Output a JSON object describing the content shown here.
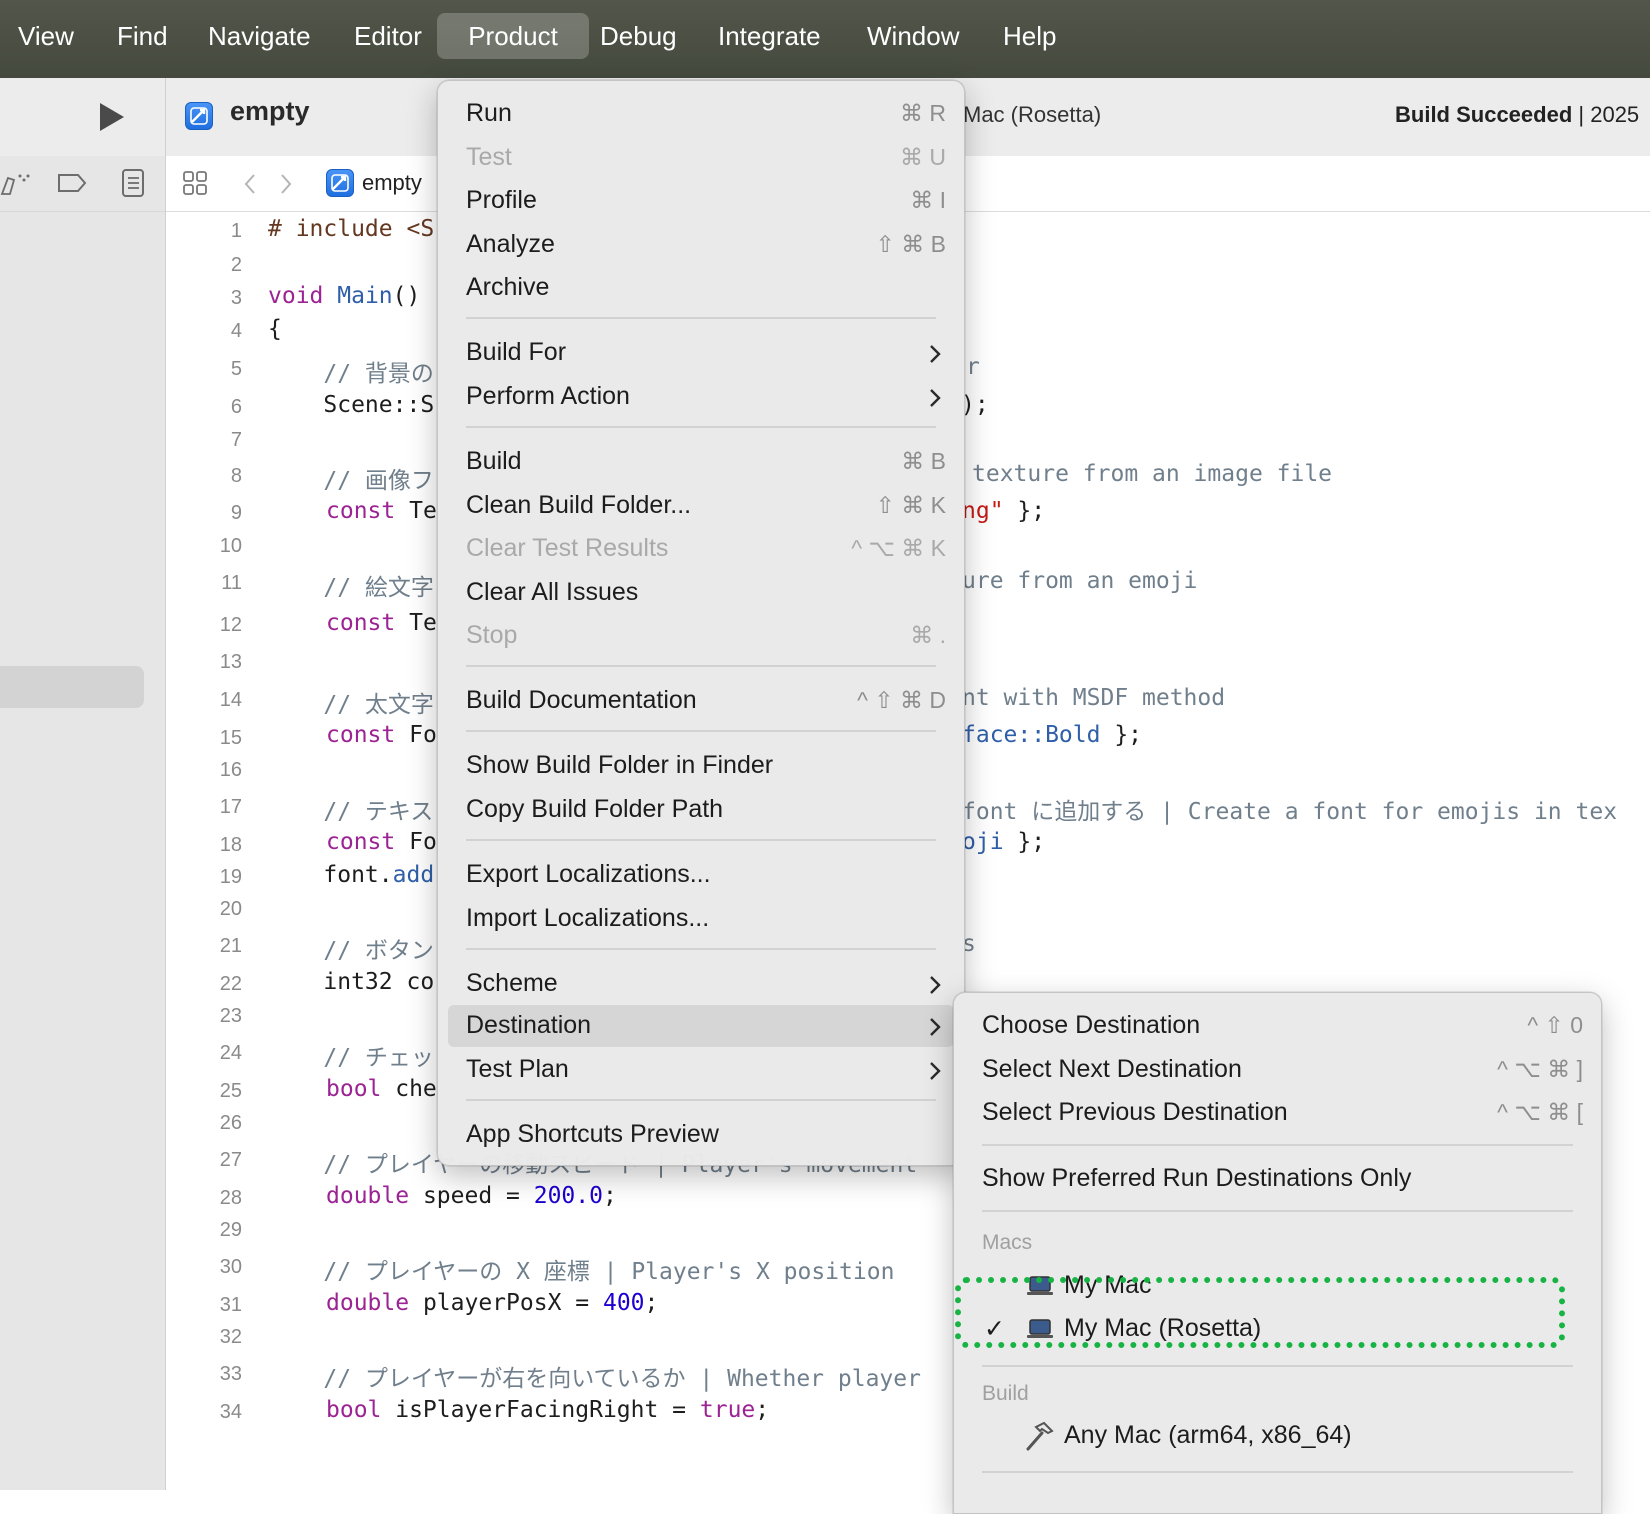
{
  "menubar": {
    "items": [
      "View",
      "Find",
      "Navigate",
      "Editor",
      "Product",
      "Debug",
      "Integrate",
      "Window",
      "Help"
    ],
    "active": "Product"
  },
  "toolbar": {
    "project": "empty",
    "destination": "Mac (Rosetta)",
    "status_bold": "Build Succeeded",
    "status_tail": " | 2025"
  },
  "jumpbar": {
    "file": "empty"
  },
  "editor": {
    "lines": [
      {
        "n": "1"
      },
      {
        "n": "2"
      },
      {
        "n": "3"
      },
      {
        "n": "4"
      },
      {
        "n": "5"
      },
      {
        "n": "6"
      },
      {
        "n": "7"
      },
      {
        "n": "8"
      },
      {
        "n": "9"
      },
      {
        "n": "10"
      },
      {
        "n": "11"
      },
      {
        "n": "12"
      },
      {
        "n": "13"
      },
      {
        "n": "14"
      },
      {
        "n": "15"
      },
      {
        "n": "16"
      },
      {
        "n": "17"
      },
      {
        "n": "18"
      },
      {
        "n": "19"
      },
      {
        "n": "20"
      },
      {
        "n": "21"
      },
      {
        "n": "22"
      },
      {
        "n": "23"
      },
      {
        "n": "24"
      },
      {
        "n": "25"
      },
      {
        "n": "26"
      },
      {
        "n": "27"
      },
      {
        "n": "28"
      },
      {
        "n": "29"
      },
      {
        "n": "30"
      },
      {
        "n": "31"
      },
      {
        "n": "32"
      },
      {
        "n": "33"
      },
      {
        "n": "34"
      }
    ],
    "code": {
      "l1_pp": "# include <S",
      "l3_kw": "void",
      "l3_fn": "Main",
      "l3_rest": "()",
      "l4": "{",
      "l5_cm": "    // 背景の",
      "l5_tail": "r",
      "l6_a": "    Scene::S",
      "l6_tail": ");",
      "l8_cm": "    // 画像フ",
      "l8_tail": "texture from an image file",
      "l9_kw": "const",
      "l9_a": " Te",
      "l9_str": "ng\"",
      "l9_tail": " };",
      "l11_cm": "    // 絵文字",
      "l11_tail": "ure from an emoji",
      "l12_kw": "const",
      "l12_a": " Te",
      "l14_cm": "    // 太文字",
      "l14_tail": "nt with MSDF method",
      "l15_kw": "const",
      "l15_a": " Fo",
      "l15_fn": "face::Bold",
      "l15_tail": " };",
      "l17_cm": "    // テキス",
      "l17_tail": "font に追加する | Create a font for emojis in tex",
      "l18_kw": "const",
      "l18_a": " Fo",
      "l18_fn": "oji",
      "l18_tail": " };",
      "l19_a": "    font.",
      "l19_fn": "add",
      "l21_cm": "    // ボタン",
      "l21_tail": "s",
      "l22_a": "    int32 co",
      "l24_cm": "    // チェッ",
      "l25_kw": "bool",
      "l25_a": " che",
      "l27_cm": "    // プレイヤーの移動スピード | Player's movement",
      "l28_kw": "double",
      "l28_a": " speed = ",
      "l28_num": "200.0",
      "l28_tail": ";",
      "l30_cm": "    // プレイヤーの X 座標 | Player's X position",
      "l31_kw": "double",
      "l31_a": " playerPosX = ",
      "l31_num": "400",
      "l31_tail": ";",
      "l33_cm": "    // プレイヤーが右を向いているか | Whether player",
      "l34_kw": "bool",
      "l34_a": " isPlayerFacingRight = ",
      "l34_kw2": "true",
      "l34_tail": ";"
    }
  },
  "product_menu": {
    "items": [
      {
        "label": "Run",
        "shortcut": "⌘ R"
      },
      {
        "label": "Test",
        "shortcut": "⌘ U"
      },
      {
        "label": "Profile",
        "shortcut": "⌘ I"
      },
      {
        "label": "Analyze",
        "shortcut": "⇧ ⌘ B"
      },
      {
        "label": "Archive",
        "shortcut": ""
      },
      {
        "label": "Build For",
        "shortcut": ""
      },
      {
        "label": "Perform Action",
        "shortcut": ""
      },
      {
        "label": "Build",
        "shortcut": "⌘ B"
      },
      {
        "label": "Clean Build Folder...",
        "shortcut": "⇧ ⌘ K"
      },
      {
        "label": "Clear Test Results",
        "shortcut": "^ ⌥ ⌘ K"
      },
      {
        "label": "Clear All Issues",
        "shortcut": ""
      },
      {
        "label": "Stop",
        "shortcut": "⌘ ."
      },
      {
        "label": "Build Documentation",
        "shortcut": "^ ⇧ ⌘ D"
      },
      {
        "label": "Show Build Folder in Finder",
        "shortcut": ""
      },
      {
        "label": "Copy Build Folder Path",
        "shortcut": ""
      },
      {
        "label": "Export Localizations...",
        "shortcut": ""
      },
      {
        "label": "Import Localizations...",
        "shortcut": ""
      },
      {
        "label": "Scheme",
        "shortcut": ""
      },
      {
        "label": "Destination",
        "shortcut": ""
      },
      {
        "label": "Test Plan",
        "shortcut": ""
      },
      {
        "label": "App Shortcuts Preview",
        "shortcut": ""
      }
    ]
  },
  "destination_menu": {
    "items": [
      {
        "label": "Choose Destination",
        "shortcut": "^ ⇧ 0"
      },
      {
        "label": "Select Next Destination",
        "shortcut": "^ ⌥ ⌘ ]"
      },
      {
        "label": "Select Previous Destination",
        "shortcut": "^ ⌥ ⌘ ["
      },
      {
        "label": "Show Preferred Run Destinations Only",
        "shortcut": ""
      }
    ],
    "section_macs": "Macs",
    "mac_1": "My Mac",
    "mac_2": "My Mac (Rosetta)",
    "checkmark": "✓",
    "section_build": "Build",
    "build_1": "Any Mac (arm64, x86_64)"
  },
  "colors": {
    "highlight_box": "#17b444",
    "menubar_bg": "#4d5044"
  }
}
